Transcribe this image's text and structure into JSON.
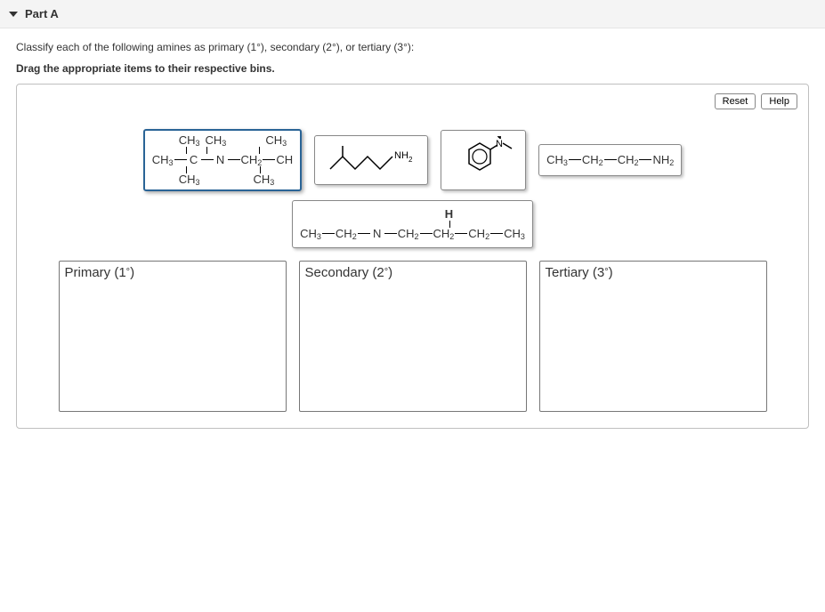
{
  "part": {
    "label": "Part A"
  },
  "prompt": "Classify each of the following amines as primary (1°), secondary (2°), or tertiary (3°):",
  "instruction": "Drag the appropriate items to their respective bins.",
  "buttons": {
    "reset": "Reset",
    "help": "Help"
  },
  "items": {
    "a_desc": "CH3-C(CH3)(CH3)-N(CH3)-CH2-CH(CH3)(CH3)",
    "b_desc": "skeletal isohexyl-NH2",
    "c_desc": "N,N-dimethylaniline skeletal",
    "d_desc": "CH3-CH2-CH2-NH2",
    "e_desc": "CH3-CH2-N(H)-CH2-CH2-CH2-CH3"
  },
  "bins": {
    "primary": "Primary (1°)",
    "secondary": "Secondary (2°)",
    "tertiary": "Tertiary (3°)"
  }
}
